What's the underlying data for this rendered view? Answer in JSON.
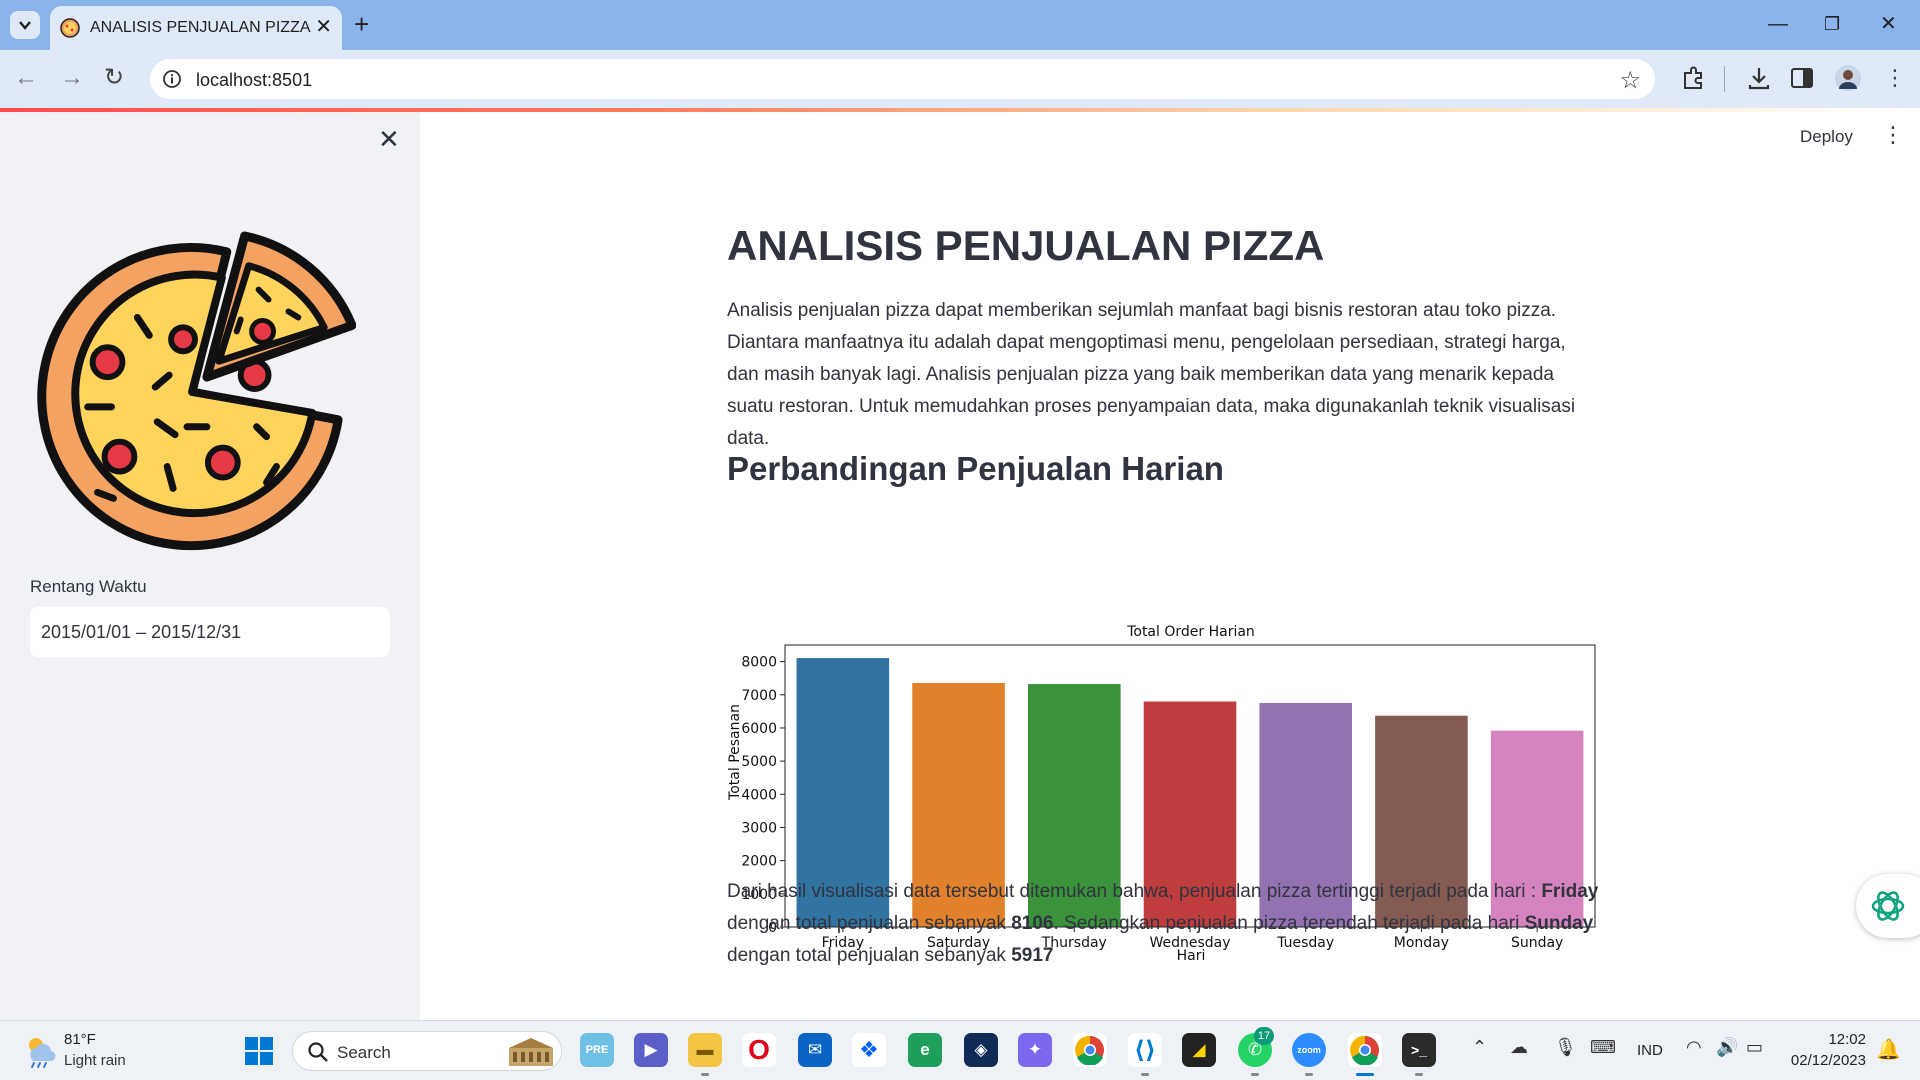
{
  "browser": {
    "tab_title": "ANALISIS PENJUALAN PIZZA",
    "url": "localhost:8501"
  },
  "sidebar": {
    "date_label": "Rentang Waktu",
    "date_value": "2015/01/01 – 2015/12/31"
  },
  "header": {
    "deploy_label": "Deploy"
  },
  "main": {
    "title": "ANALISIS PENJUALAN PIZZA",
    "intro": "Analisis penjualan pizza dapat memberikan sejumlah manfaat bagi bisnis restoran atau toko pizza. Diantara manfaatnya itu adalah dapat mengoptimasi menu, pengelolaan persediaan, strategi harga, dan masih banyak lagi. Analisis penjualan pizza yang baik memberikan data yang menarik kepada suatu restoran. Untuk memudahkan proses penyampaian data, maka digunakanlah teknik visualisasi data.",
    "section_heading": "Perbandingan Penjualan Harian",
    "conclusion": {
      "part1": "Dari hasil visualisasi data tersebut ditemukan bahwa, penjualan pizza tertinggi terjadi pada hari : ",
      "top_day": "Friday",
      "part2": " dengan total penjualan sebanyak ",
      "top_value": "8106",
      "part3": ". Sedangkan penjualan pizza terendah terjadi pada hari ",
      "low_day": "Sunday",
      "part4": " dengan total penjualan sebanyak ",
      "low_value": "5917"
    }
  },
  "chart_data": {
    "type": "bar",
    "title": "Total Order Harian",
    "xlabel": "Hari",
    "ylabel": "Total Pesanan",
    "categories": [
      "Friday",
      "Saturday",
      "Thursday",
      "Wednesday",
      "Tuesday",
      "Monday",
      "Sunday"
    ],
    "values": [
      8106,
      7355,
      7323,
      6797,
      6753,
      6369,
      5917
    ],
    "colors": [
      "#3274a1",
      "#e1812c",
      "#3a923a",
      "#c03d3e",
      "#9372b2",
      "#845b53",
      "#d684bd"
    ],
    "ylim": [
      0,
      8500
    ],
    "yticks": [
      0,
      1000,
      2000,
      3000,
      4000,
      5000,
      6000,
      7000,
      8000
    ],
    "grid": false,
    "legend": "none"
  },
  "taskbar": {
    "weather_temp": "81°F",
    "weather_desc": "Light rain",
    "search_label": "Search",
    "whatsapp_badge": "17",
    "language": "IND",
    "time": "12:02",
    "date": "02/12/2023"
  }
}
